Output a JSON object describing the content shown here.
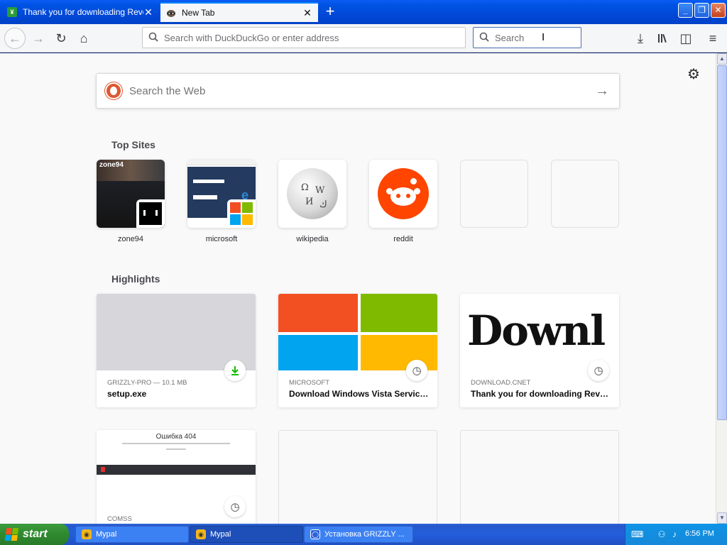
{
  "browser": {
    "tabs": [
      {
        "title": "Thank you for downloading Revo Uninstaller",
        "favicon": "cnet-icon",
        "active": false,
        "close_glyph": "✕"
      },
      {
        "title": "New Tab",
        "favicon": "raccoon-icon",
        "active": true,
        "close_glyph": "✕"
      }
    ],
    "new_tab_glyph": "+",
    "window_buttons": {
      "minimize": "_",
      "maximize": "❐",
      "close": "✕"
    },
    "nav": {
      "back_glyph": "←",
      "forward_glyph": "→",
      "reload_glyph": "↻",
      "home_glyph": "⌂"
    },
    "urlbar": {
      "placeholder": "Search with DuckDuckGo or enter address"
    },
    "searchbar": {
      "placeholder": "Search"
    },
    "toolbar_icons": {
      "downloads": "⤓",
      "library": "|||\\",
      "sidebar": "◫",
      "menu": "≡"
    }
  },
  "newtab": {
    "settings_glyph": "⚙",
    "search": {
      "placeholder": "Search the Web",
      "go_glyph": "→"
    },
    "top_sites_title": "Top Sites",
    "top_sites": [
      {
        "label": "zone94",
        "screenshot_title": "zone94"
      },
      {
        "label": "microsoft"
      },
      {
        "label": "wikipedia"
      },
      {
        "label": "reddit"
      },
      {
        "label": ""
      },
      {
        "label": ""
      }
    ],
    "highlights_title": "Highlights",
    "highlights": [
      {
        "source": "GRIZZLY-PRO — 10.1 MB",
        "title": "setup.exe",
        "badge": "download-icon",
        "badge_glyph": "↓"
      },
      {
        "source": "MICROSOFT",
        "title": "Download Windows Vista Service Pack",
        "badge": "clock-icon",
        "badge_glyph": "◷"
      },
      {
        "source": "DOWNLOAD.CNET",
        "title": "Thank you for downloading Revo Uninstaller",
        "badge": "clock-icon",
        "badge_glyph": "◷",
        "thumb_text": "Downl"
      },
      {
        "source": "COMSS",
        "title": "",
        "badge": "clock-icon",
        "badge_glyph": "◷",
        "thumb_heading": "Ошибка 404"
      }
    ]
  },
  "taskbar": {
    "start_label": "start",
    "tasks": [
      {
        "label": "Mypal",
        "active": false
      },
      {
        "label": "Mypal",
        "active": true
      },
      {
        "label": "Установка GRIZZLY ...",
        "active": false
      }
    ],
    "clock": "6:56 PM"
  },
  "colors": {
    "xp_blue": "#0054e3",
    "tab_accent": "#0a84ff",
    "ddg_orange": "#de5833",
    "reddit_orange": "#ff4500",
    "download_green": "#12bc00",
    "ms_red": "#f25022",
    "ms_green": "#7fba00",
    "ms_blue": "#00a4ef",
    "ms_yellow": "#ffb900"
  }
}
